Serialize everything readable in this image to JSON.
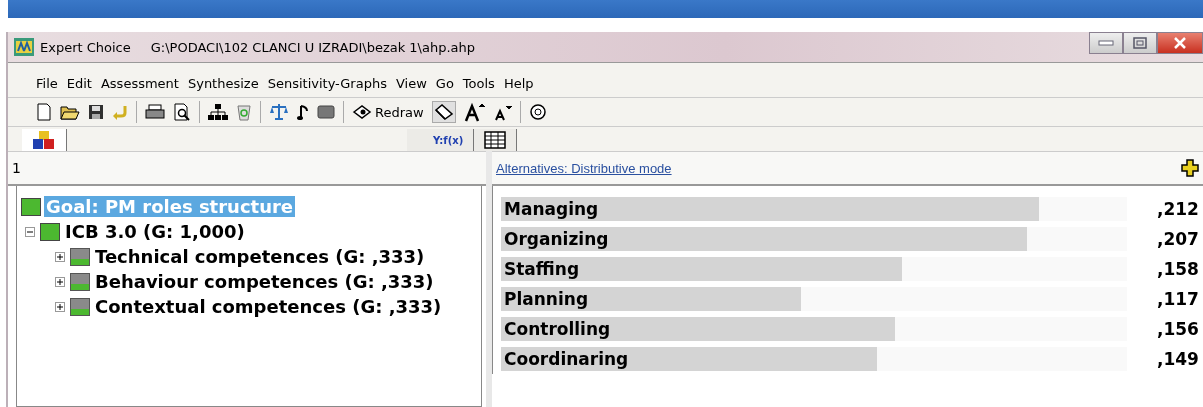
{
  "window": {
    "app_name": "Expert Choice",
    "title": "G:\\PODACI\\102 CLANCI U IZRADI\\bezak 1\\ahp.ahp"
  },
  "menu": [
    "File",
    "Edit",
    "Assessment",
    "Synthesize",
    "Sensitivity-Graphs",
    "View",
    "Go",
    "Tools",
    "Help"
  ],
  "toolbar": {
    "redraw_label": "Redraw"
  },
  "tabs": [
    {
      "kind": "model",
      "selected": true
    },
    {
      "kind": "formula",
      "label": "Y:f(x)",
      "selected": false
    },
    {
      "kind": "grid",
      "selected": false
    }
  ],
  "left_pane": {
    "header": "1",
    "tree": [
      {
        "label": "Goal: PM roles structure",
        "kind": "goal",
        "selected": true,
        "children": [
          {
            "label": "ICB 3.0 (G: 1,000)",
            "kind": "full",
            "selected": false,
            "expanded": true,
            "children": [
              {
                "label": "Technical competences (G: ,333)",
                "kind": "split",
                "selected": false,
                "expanded": false
              },
              {
                "label": "Behaviour competences (G: ,333)",
                "kind": "split",
                "selected": false,
                "expanded": false
              },
              {
                "label": "Contextual competences (G: ,333)",
                "kind": "split",
                "selected": false,
                "expanded": false
              }
            ]
          }
        ]
      }
    ]
  },
  "right_pane": {
    "link": "Alternatives: Distributive mode",
    "alternatives": [
      {
        "name": "Managing",
        "level": 0.86,
        "value": ",212"
      },
      {
        "name": "Organizing",
        "level": 0.84,
        "value": ",207"
      },
      {
        "name": "Staffing",
        "level": 0.64,
        "value": ",158"
      },
      {
        "name": "Planning",
        "level": 0.48,
        "value": ",117"
      },
      {
        "name": "Controlling",
        "level": 0.63,
        "value": ",156"
      },
      {
        "name": "Coordinaring",
        "level": 0.6,
        "value": ",149"
      }
    ]
  }
}
